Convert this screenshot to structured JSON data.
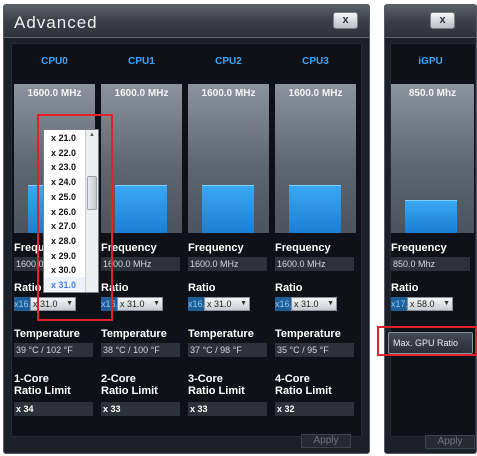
{
  "main_window": {
    "title": "Advanced",
    "close_label": "x",
    "apply_label": "Apply",
    "cpus": [
      {
        "name": "CPU0",
        "gauge_mhz": "1600.0 MHz",
        "frequency_label": "Frequency",
        "frequency": "1600.0 MHz",
        "ratio_label": "Ratio",
        "ratio_current": "x16.0",
        "ratio_selected": "x 31.0",
        "temperature_label": "Temperature",
        "temperature": "39 °C / 102 °F",
        "limit_label_1": "1-Core",
        "limit_label_2": "Ratio Limit",
        "limit_value": "x 34",
        "gauge_fill": 0.4
      },
      {
        "name": "CPU1",
        "gauge_mhz": "1600.0 MHz",
        "frequency_label": "Frequency",
        "frequency": "1600.0 MHz",
        "ratio_label": "Ratio",
        "ratio_current": "x16.0",
        "ratio_selected": "x 31.0",
        "temperature_label": "Temperature",
        "temperature": "38 °C / 100 °F",
        "limit_label_1": "2-Core",
        "limit_label_2": "Ratio Limit",
        "limit_value": "x 33",
        "gauge_fill": 0.4
      },
      {
        "name": "CPU2",
        "gauge_mhz": "1600.0 MHz",
        "frequency_label": "Frequency",
        "frequency": "1600.0 MHz",
        "ratio_label": "Ratio",
        "ratio_current": "x16.0",
        "ratio_selected": "x 31.0",
        "temperature_label": "Temperature",
        "temperature": "37 °C / 98 °F",
        "limit_label_1": "3-Core",
        "limit_label_2": "Ratio Limit",
        "limit_value": "x 33",
        "gauge_fill": 0.4
      },
      {
        "name": "CPU3",
        "gauge_mhz": "1600.0 MHz",
        "frequency_label": "Frequency",
        "frequency": "1600.0 MHz",
        "ratio_label": "Ratio",
        "ratio_current": "x16.0",
        "ratio_selected": "x 31.0",
        "temperature_label": "Temperature",
        "temperature": "35 °C / 95 °F",
        "limit_label_1": "4-Core",
        "limit_label_2": "Ratio Limit",
        "limit_value": "x 32",
        "gauge_fill": 0.4
      }
    ],
    "ratio_dropdown": {
      "options": [
        "x 21.0",
        "x 22.0",
        "x 23.0",
        "x 24.0",
        "x 25.0",
        "x 26.0",
        "x 27.0",
        "x 28.0",
        "x 29.0",
        "x 30.0",
        "x 31.0"
      ],
      "selected": "x 31.0"
    },
    "occluded_labels": {
      "frequency": "Frequ",
      "frequency_value": "1600.",
      "ratio": "Rati"
    }
  },
  "gpu_window": {
    "close_label": "x",
    "name": "iGPU",
    "gauge_mhz": "850.0 Mhz",
    "gauge_fill": 0.22,
    "frequency_label": "Frequency",
    "frequency": "850.0 Mhz",
    "ratio_label": "Ratio",
    "ratio_current": "x17.0",
    "ratio_selected": "x 58.0",
    "max_ratio_button": "Max. GPU Ratio",
    "apply_label": "Apply"
  },
  "colors": {
    "accent": "#39a6ff",
    "highlight": "#e2222a",
    "gauge_bar": "#2a94e6"
  }
}
